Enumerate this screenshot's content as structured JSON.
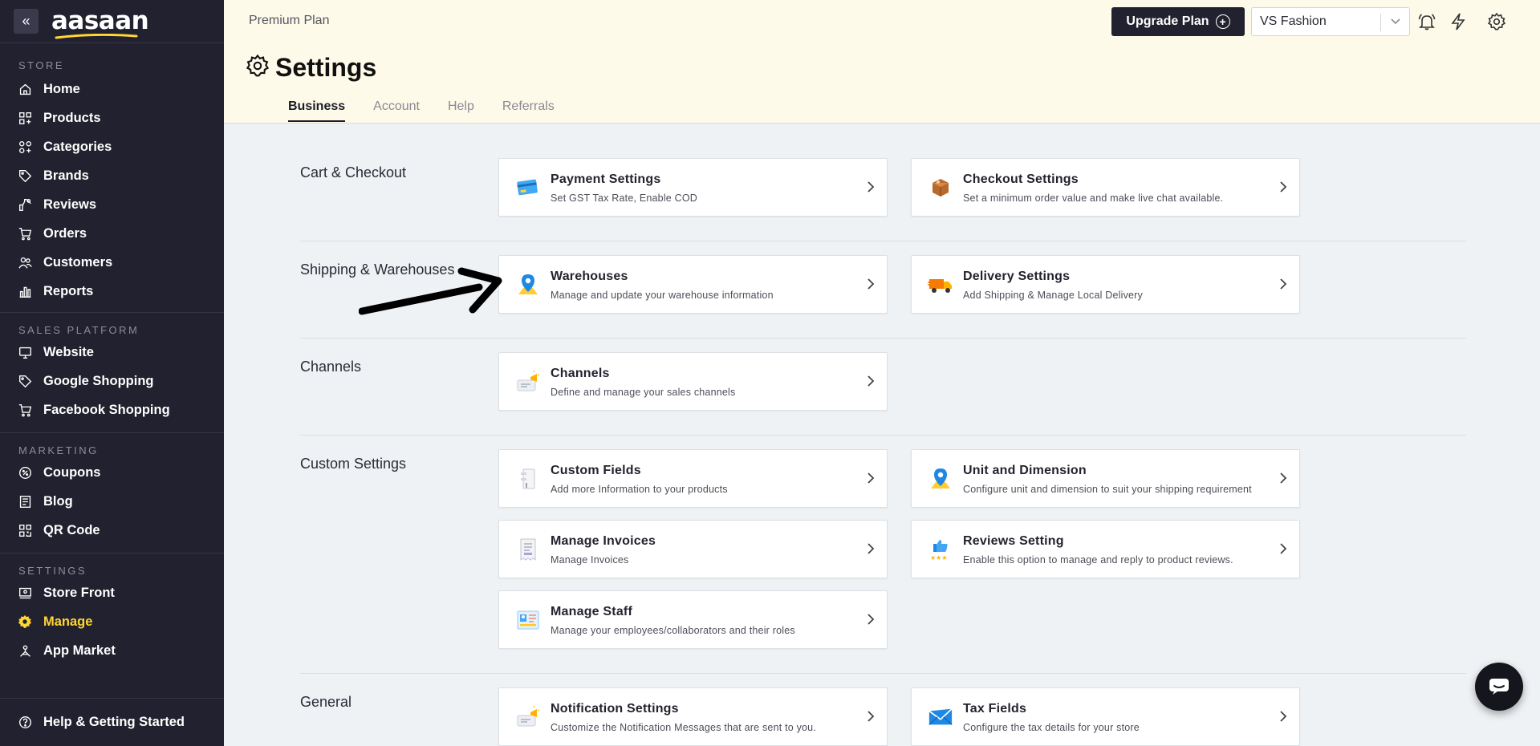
{
  "app": {
    "logo_text": "aasaan"
  },
  "sidebar": {
    "sections": [
      {
        "title": "STORE",
        "items": [
          {
            "label": "Home",
            "icon": "home-icon"
          },
          {
            "label": "Products",
            "icon": "products-icon"
          },
          {
            "label": "Categories",
            "icon": "categories-icon"
          },
          {
            "label": "Brands",
            "icon": "tag-icon"
          },
          {
            "label": "Reviews",
            "icon": "reviews-icon"
          },
          {
            "label": "Orders",
            "icon": "cart-icon"
          },
          {
            "label": "Customers",
            "icon": "customers-icon"
          },
          {
            "label": "Reports",
            "icon": "bar-chart-icon"
          }
        ]
      },
      {
        "title": "SALES PLATFORM",
        "items": [
          {
            "label": "Website",
            "icon": "monitor-icon"
          },
          {
            "label": "Google Shopping",
            "icon": "tag-icon"
          },
          {
            "label": "Facebook Shopping",
            "icon": "cart-icon"
          }
        ]
      },
      {
        "title": "MARKETING",
        "items": [
          {
            "label": "Coupons",
            "icon": "coupon-icon"
          },
          {
            "label": "Blog",
            "icon": "blog-icon"
          },
          {
            "label": "QR Code",
            "icon": "qr-code-icon"
          }
        ]
      },
      {
        "title": "SETTINGS",
        "items": [
          {
            "label": "Store Front",
            "icon": "store-front-icon"
          },
          {
            "label": "Manage",
            "icon": "gear-icon",
            "active": true
          },
          {
            "label": "App Market",
            "icon": "app-market-icon"
          }
        ]
      }
    ],
    "footer_item": {
      "label": "Help & Getting Started",
      "icon": "help-icon"
    }
  },
  "header": {
    "plan_label": "Premium Plan",
    "upgrade_label": "Upgrade Plan",
    "store_selected": "VS Fashion",
    "title": "Settings",
    "tabs": [
      {
        "label": "Business",
        "active": true
      },
      {
        "label": "Account"
      },
      {
        "label": "Help"
      },
      {
        "label": "Referrals"
      }
    ]
  },
  "sections": [
    {
      "title": "Cart & Checkout",
      "cards": [
        {
          "title": "Payment Settings",
          "desc": "Set GST Tax Rate, Enable COD",
          "icon": "credit-card-icon"
        },
        {
          "title": "Checkout Settings",
          "desc": "Set a minimum order value and make live chat available.",
          "icon": "package-box-icon"
        }
      ]
    },
    {
      "title": "Shipping & Warehouses",
      "cards": [
        {
          "title": "Warehouses",
          "desc": "Manage and update your warehouse information",
          "icon": "map-pin-icon"
        },
        {
          "title": "Delivery Settings",
          "desc": "Add Shipping & Manage Local Delivery",
          "icon": "delivery-truck-icon"
        }
      ]
    },
    {
      "title": "Channels",
      "cards": [
        {
          "title": "Channels",
          "desc": "Define and manage your sales channels",
          "icon": "megaphone-icon"
        }
      ]
    },
    {
      "title": "Custom Settings",
      "cards": [
        {
          "title": "Custom Fields",
          "desc": "Add more Information to your products",
          "icon": "custom-fields-icon"
        },
        {
          "title": "Unit and Dimension",
          "desc": "Configure unit and dimension to suit your shipping requirement",
          "icon": "map-pin-icon"
        },
        {
          "title": "Manage Invoices",
          "desc": "Manage Invoices",
          "icon": "invoice-icon"
        },
        {
          "title": "Reviews Setting",
          "desc": "Enable this option to manage and reply to product reviews.",
          "icon": "thumbs-up-icon"
        },
        {
          "title": "Manage Staff",
          "desc": "Manage your employees/collaborators and their roles",
          "icon": "staff-board-icon"
        }
      ]
    },
    {
      "title": "General",
      "cards": [
        {
          "title": "Notification Settings",
          "desc": "Customize the Notification Messages that are sent to you.",
          "icon": "megaphone-icon"
        },
        {
          "title": "Tax Fields",
          "desc": "Configure the tax details for your store",
          "icon": "envelope-icon"
        }
      ]
    }
  ],
  "colors": {
    "sidebar_bg": "#21212f",
    "accent_yellow": "#ffd633",
    "header_bg": "#fdfaea",
    "content_bg": "#eff2f5"
  }
}
